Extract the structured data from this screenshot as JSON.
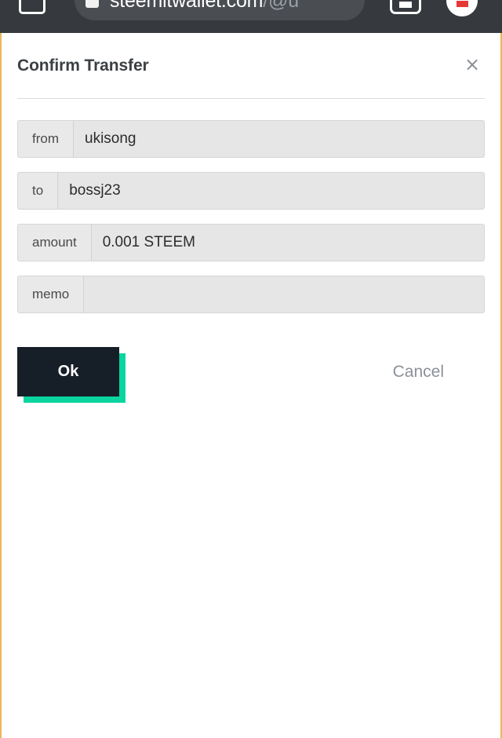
{
  "browser": {
    "url_display": "steemitwallet.com",
    "url_path": "/@u",
    "tab_square_icon": "tab-square-icon",
    "url_lock_icon": "page-icon",
    "tab_count_icon": "tab-count-icon",
    "menu_icon": "menu-circle-icon"
  },
  "modal": {
    "title": "Confirm Transfer",
    "close_label": "×",
    "close_icon": "close-icon",
    "fields": [
      {
        "label": "from",
        "value": "ukisong",
        "name": "from"
      },
      {
        "label": "to",
        "value": "bossj23",
        "name": "to"
      },
      {
        "label": "amount",
        "value": "0.001 STEEM",
        "name": "amount"
      },
      {
        "label": "memo",
        "value": "",
        "name": "memo"
      }
    ],
    "ok_label": "Ok",
    "cancel_label": "Cancel"
  },
  "colors": {
    "accent_teal": "#09d5a1",
    "button_dark": "#161e27",
    "page_border": "#eab75a",
    "chrome_bg": "#36393d",
    "cancel_text": "#8b9199"
  }
}
